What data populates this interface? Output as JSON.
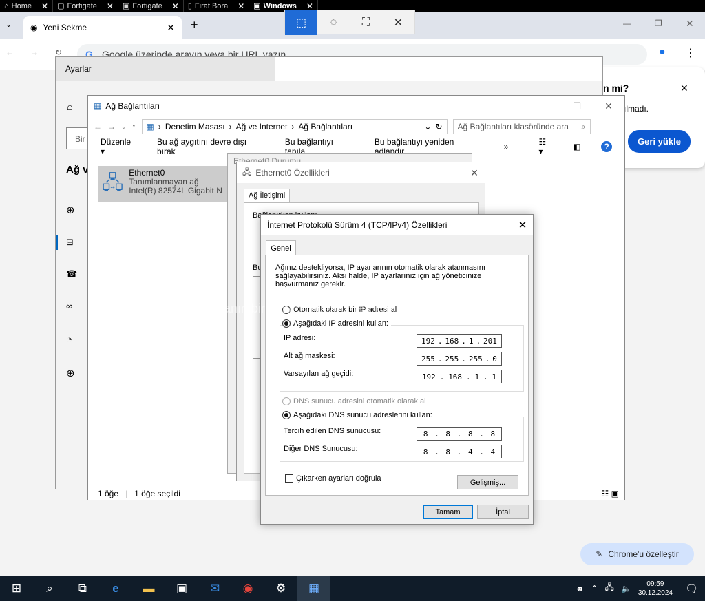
{
  "rdp_tabs": [
    {
      "label": "Home"
    },
    {
      "label": "Fortigate"
    },
    {
      "label": "Fortigate"
    },
    {
      "label": "Firat Bora"
    },
    {
      "label": "Windows"
    }
  ],
  "chrome": {
    "tab_title": "Yeni Sekme",
    "omnibox_placeholder": "Google üzerinde arayın veya bir URL yazın",
    "restore": {
      "heading_fragment": "n mi?",
      "body_fragment": "ılmadı.",
      "button": "Geri yükle"
    },
    "customize_button": "Chrome'u özelleştir"
  },
  "settings_window": {
    "title": "Ayarlar",
    "search_fragment": "Bir",
    "nav_heading_fragment": "Ağ ve"
  },
  "network_connections": {
    "title": "Ağ Bağlantıları",
    "breadcrumb": [
      "Denetim Masası",
      "Ağ ve Internet",
      "Ağ Bağlantıları"
    ],
    "search_placeholder": "Ağ Bağlantıları klasöründe ara",
    "commands": [
      "Düzenle ▾",
      "Bu ağ aygıtını devre dışı bırak",
      "Bu bağlantıyı tanıla",
      "Bu bağlantıyı yeniden adlandır",
      "»"
    ],
    "adapter": {
      "name": "Ethernet0",
      "status": "Tanımlanmayan ağ",
      "device": "Intel(R) 82574L Gigabit N"
    },
    "status_bar": {
      "count": "1 öğe",
      "selected": "1 öğe seçildi"
    }
  },
  "ethernet_status_title": "Ethernet0 Durumu",
  "ethernet_props": {
    "title": "Ethernet0 Özellikleri",
    "tab": "Ağ İletişimi",
    "connect_fragment": "Bağlanırken kullan:",
    "uses_fragment": "Bu"
  },
  "tcpip": {
    "title": "İnternet Protokolü Sürüm 4 (TCP/IPv4) Özellikleri",
    "tab": "Genel",
    "info": "Ağınız destekliyorsa, IP ayarlarının otomatik olarak atanmasını sağlayabilirsiniz. Aksi halde, IP ayarlarınız için ağ yöneticinize başvurmanız gerekir.",
    "auto_ip": "Otomatik olarak bir IP adresi al",
    "manual_ip": "Aşağıdaki IP adresini kullan:",
    "ip_label": "IP adresi:",
    "ip": [
      "192",
      "168",
      "1",
      "201"
    ],
    "mask_label": "Alt ağ maskesi:",
    "mask": [
      "255",
      "255",
      "255",
      "0"
    ],
    "gateway_label": "Varsayılan ağ geçidi:",
    "gateway": [
      "192",
      "168",
      "1",
      "1"
    ],
    "auto_dns": "DNS sunucu adresini otomatik olarak al",
    "manual_dns": "Aşağıdaki DNS sunucu adreslerini kullan:",
    "pref_dns_label": "Tercih edilen DNS sunucusu:",
    "pref_dns": [
      "8",
      "8",
      "8",
      "8"
    ],
    "alt_dns_label": "Diğer DNS Sunucusu:",
    "alt_dns": [
      "8",
      "8",
      "4",
      "4"
    ],
    "validate": "Çıkarken ayarları doğrula",
    "advanced": "Gelişmiş...",
    "ok": "Tamam",
    "cancel": "İptal"
  },
  "watermark": "Ekranın bir bölümünü kırpmak için bir şekil çizin",
  "clock": {
    "time": "09:59",
    "date": "30.12.2024"
  }
}
